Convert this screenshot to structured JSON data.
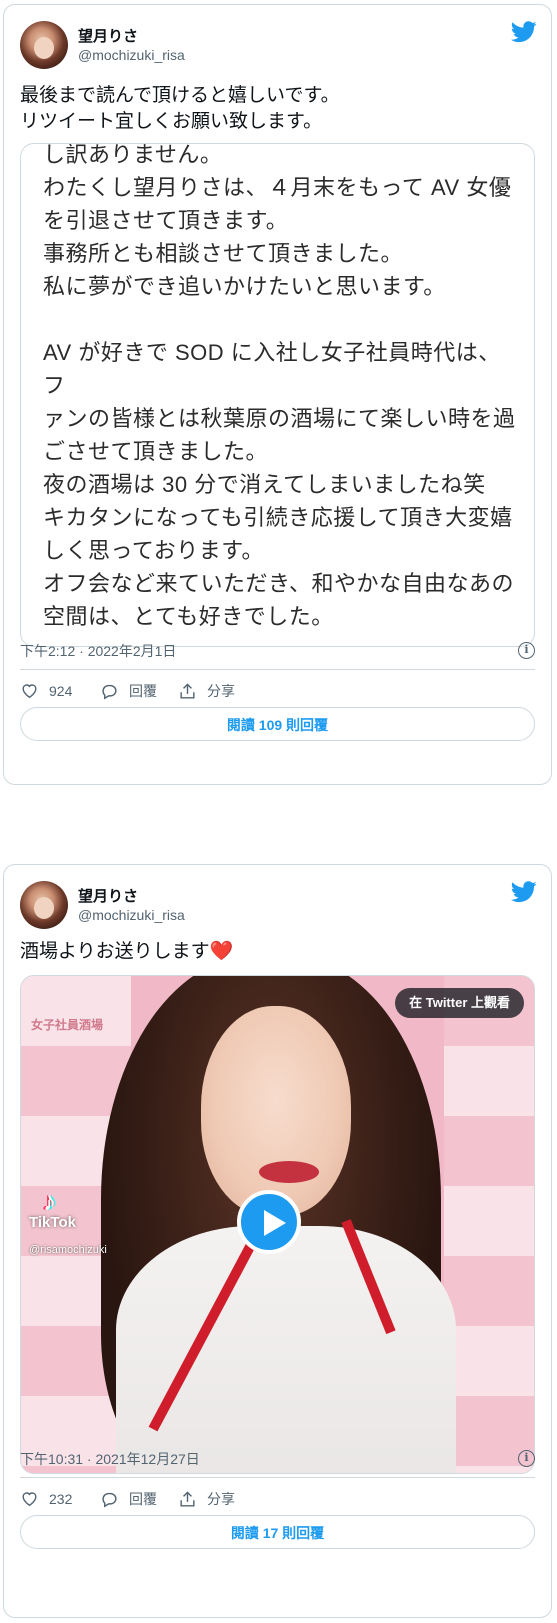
{
  "tweets": [
    {
      "user": {
        "name": "望月りさ",
        "handle": "@mochizuki_risa"
      },
      "text": "最後まで読んで頂けると嬉しいです。\nリツイート宜しくお願い致します。",
      "image_text": "し訳ありません。\nわたくし望月りさは、４月末をもって AV 女優\nを引退させて頂きます。\n事務所とも相談させて頂きました。\n私に夢ができ追いかけたいと思います。\n\nAV が好きで SOD に入社し女子社員時代は、フ\nァンの皆様とは秋葉原の酒場にて楽しい時を過\nごさせて頂きました。\n夜の酒場は 30 分で消えてしまいましたね笑\nキカタンになっても引続き応援して頂き大変嬉\nしく思っております。\nオフ会など来ていただき、和やかな自由なあの\n空間は、とても好きでした。\n\n引退までの全節イベントを行い　出してもファン",
      "timestamp": "下午2:12 · 2022年2月1日",
      "likes": "924",
      "reply_label": "回覆",
      "share_label": "分享",
      "read_replies": "閱讀 109 則回覆"
    },
    {
      "user": {
        "name": "望月りさ",
        "handle": "@mochizuki_risa"
      },
      "text": "酒場よりお送りします",
      "heart": "❤️",
      "video": {
        "watch_label": "在 Twitter 上觀看",
        "tiktok_label": "TikTok",
        "tiktok_user": "@risamochizuki",
        "sign_text": "女子社員酒場"
      },
      "timestamp": "下午10:31 · 2021年12月27日",
      "likes": "232",
      "reply_label": "回覆",
      "share_label": "分享",
      "read_replies": "閱讀 17 則回覆"
    }
  ],
  "colors": {
    "brand": "#1d9bf0",
    "border": "#cfd9de",
    "muted": "#536471",
    "text": "#0f1419"
  },
  "icons": [
    "twitter-bird-icon",
    "info-icon",
    "heart-icon",
    "reply-icon",
    "share-icon",
    "play-icon"
  ]
}
